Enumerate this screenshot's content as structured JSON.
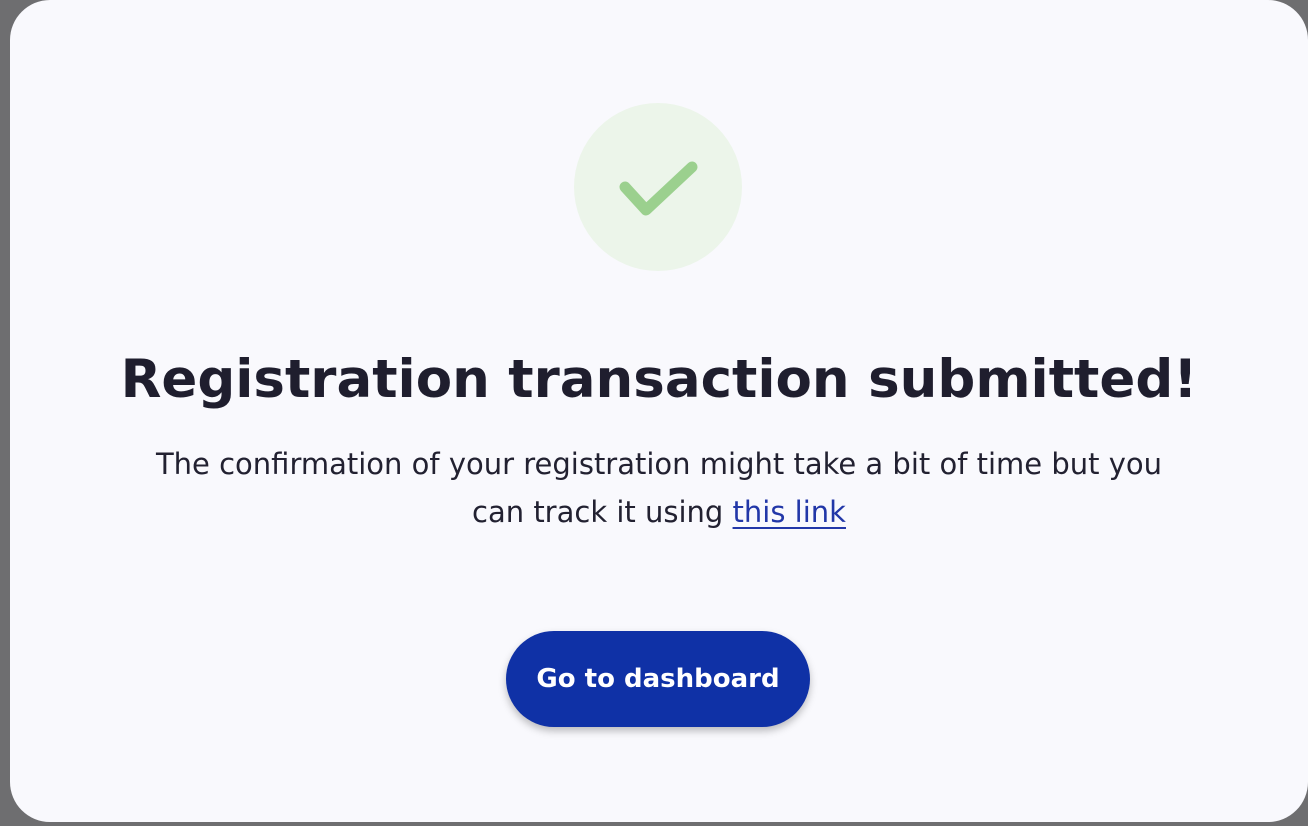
{
  "modal": {
    "icon": "checkmark-icon",
    "title": "Registration transaction submitted!",
    "message_before_link": "The confirmation of your registration might take a bit of time but you can track it using ",
    "link_text": "this link",
    "button_label": "Go to dashboard"
  },
  "colors": {
    "background": "#f9f9fd",
    "check_circle": "#ecf5ea",
    "check_mark": "#9bd08e",
    "button": "#0f31a6",
    "link": "#2237a8",
    "text": "#1f1e2e"
  }
}
